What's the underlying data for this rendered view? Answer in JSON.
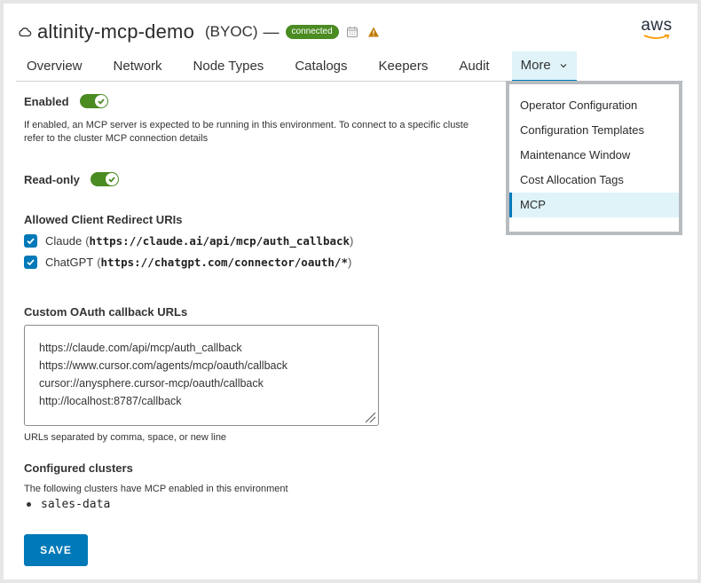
{
  "header": {
    "title": "altinity-mcp-demo",
    "type": "(BYOC)",
    "separator": "—",
    "status": "connected",
    "provider": "aws",
    "colors": {
      "status": "#4a8b22",
      "warning": "#c07a00",
      "accent": "#0079b8"
    }
  },
  "tabs": [
    {
      "label": "Overview"
    },
    {
      "label": "Network"
    },
    {
      "label": "Node Types"
    },
    {
      "label": "Catalogs"
    },
    {
      "label": "Keepers"
    },
    {
      "label": "Audit"
    },
    {
      "label": "More"
    }
  ],
  "more_menu": {
    "items": [
      {
        "label": "Operator Configuration"
      },
      {
        "label": "Configuration Templates"
      },
      {
        "label": "Maintenance Window"
      },
      {
        "label": "Cost Allocation Tags"
      },
      {
        "label": "MCP"
      }
    ],
    "selected": "MCP"
  },
  "enabled": {
    "label": "Enabled",
    "on": true,
    "description_line1": "If enabled, an MCP server is expected to be running in this environment. To connect to a specific cluste",
    "description_line2": "refer to the cluster MCP connection details"
  },
  "readonly": {
    "label": "Read-only",
    "on": true
  },
  "redirects": {
    "label": "Allowed Client Redirect URIs",
    "items": [
      {
        "name": "Claude",
        "url": "https://claude.ai/api/mcp/auth_callback",
        "checked": true
      },
      {
        "name": "ChatGPT",
        "url": "https://chatgpt.com/connector/oauth/*",
        "checked": true
      }
    ]
  },
  "custom_oauth": {
    "label": "Custom OAuth callback URLs",
    "lines": [
      "https://claude.com/api/mcp/auth_callback",
      "https://www.cursor.com/agents/mcp/oauth/callback",
      "cursor://anysphere.cursor-mcp/oauth/callback",
      "http://localhost:8787/callback"
    ],
    "hint": "URLs separated by comma, space, or new line"
  },
  "clusters": {
    "label": "Configured clusters",
    "description": "The following clusters have MCP enabled in this environment",
    "items": [
      "sales-data"
    ]
  },
  "save_label": "SAVE",
  "icons": [
    "cloud-icon",
    "calendar-icon",
    "warning-icon",
    "aws-logo-icon",
    "chevron-down-icon",
    "check-icon",
    "resize-handle-icon"
  ]
}
